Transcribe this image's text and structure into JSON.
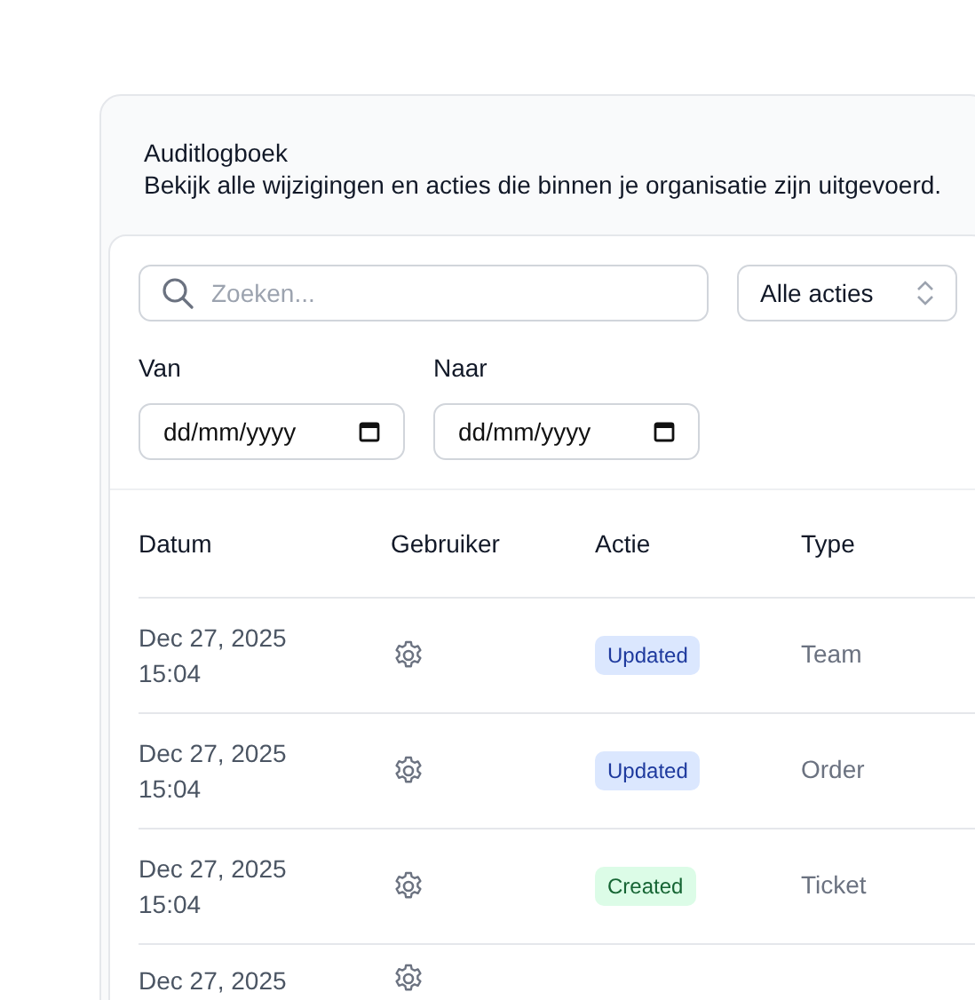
{
  "header": {
    "title": "Auditlogboek",
    "description": "Bekijk alle wijzigingen en acties die binnen je organisatie zijn uitgevoerd."
  },
  "filters": {
    "search": {
      "placeholder": "Zoeken..."
    },
    "action_select": {
      "value": "Alle acties"
    },
    "date_from": {
      "label": "Van",
      "placeholder": "dd/mm/yyyy"
    },
    "date_to": {
      "label": "Naar",
      "placeholder": "dd/mm/yyyy"
    }
  },
  "table": {
    "columns": [
      "Datum",
      "Gebruiker",
      "Actie",
      "Type"
    ],
    "rows": [
      {
        "date": "Dec 27, 2025",
        "time": "15:04",
        "action": {
          "label": "Updated",
          "kind": "updated"
        },
        "type": "Team"
      },
      {
        "date": "Dec 27, 2025",
        "time": "15:04",
        "action": {
          "label": "Updated",
          "kind": "updated"
        },
        "type": "Order"
      },
      {
        "date": "Dec 27, 2025",
        "time": "15:04",
        "action": {
          "label": "Created",
          "kind": "created"
        },
        "type": "Ticket"
      },
      {
        "date": "Dec 27, 2025"
      }
    ]
  }
}
